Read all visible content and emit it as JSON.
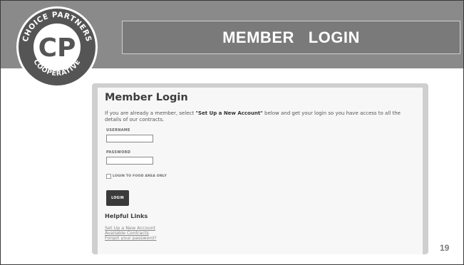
{
  "slide": {
    "title": "MEMBER   LOGIN",
    "page_number": "19",
    "logo": {
      "top_text": "CHOICE PARTNERS",
      "bottom_text": "COOPERATIVE",
      "monogram": "CP"
    }
  },
  "login_form": {
    "heading": "Member Login",
    "intro_before": "If you are already a member, select ",
    "intro_bold": "\"Set Up a New Account\"",
    "intro_after": " below and get your login so you have access to all the details of our contracts.",
    "username_label": "USERNAME",
    "username_value": "",
    "password_label": "PASSWORD",
    "password_value": "",
    "food_area_checkbox_label": "LOGIN TO FOOD AREA ONLY",
    "login_button_label": "LOGIN"
  },
  "helpful_links": {
    "heading": "Helpful Links",
    "items": [
      "Set Up a New Account",
      "Available Contracts",
      "Forgot your password?"
    ]
  },
  "colors": {
    "header_band": "#8a8a8a",
    "title_box": "#7a7a7a",
    "button": "#3a3a3a"
  }
}
